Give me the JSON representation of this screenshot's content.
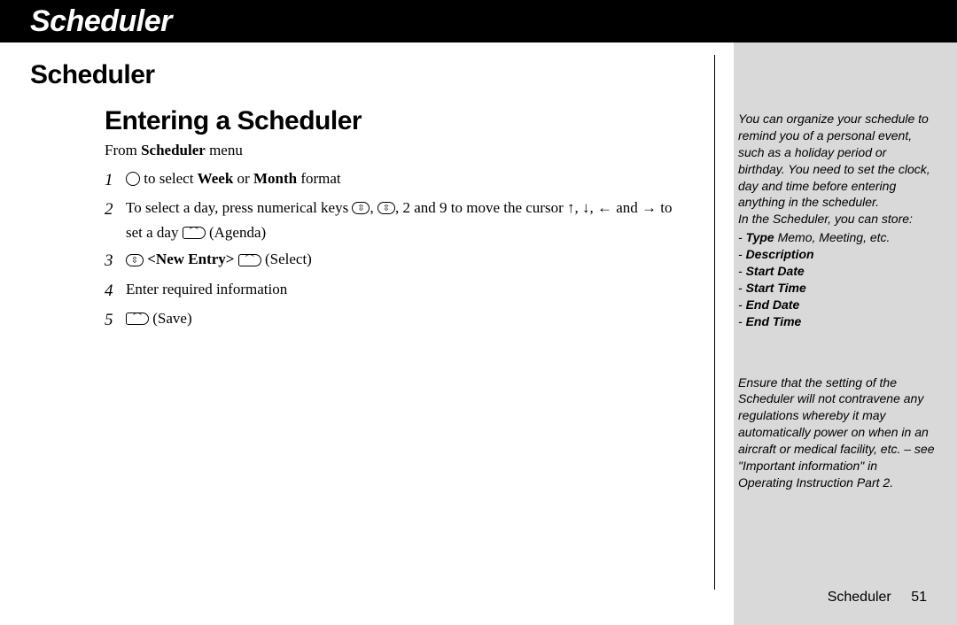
{
  "header": {
    "title": "Scheduler"
  },
  "breadcrumb": {
    "prefix": ">",
    "label": "Scheduler"
  },
  "section_label": "Scheduler",
  "heading": "Entering a Scheduler",
  "from_line": {
    "prefix": "From ",
    "bold": "Scheduler",
    "suffix": " menu"
  },
  "steps": [
    {
      "num": "1",
      "parts": [
        {
          "icon": "direction-key"
        },
        {
          "text": " to select "
        },
        {
          "bold": "Week"
        },
        {
          "text": " or "
        },
        {
          "bold": "Month"
        },
        {
          "text": " format"
        }
      ]
    },
    {
      "num": "2",
      "parts": [
        {
          "text": "To select a day, press numerical keys "
        },
        {
          "icon": "updown-key"
        },
        {
          "text": ", "
        },
        {
          "icon": "updown-key"
        },
        {
          "text": ", 2 and 9 to move the cursor ↑, ↓, ← and → to set a day "
        },
        {
          "icon": "soft-key"
        },
        {
          "text": " (Agenda)"
        }
      ]
    },
    {
      "num": "3",
      "parts": [
        {
          "icon": "updown-key"
        },
        {
          "text": " "
        },
        {
          "bold": "<New Entry>"
        },
        {
          "text": " "
        },
        {
          "icon": "soft-key"
        },
        {
          "text": " (Select)"
        }
      ]
    },
    {
      "num": "4",
      "parts": [
        {
          "text": "Enter required information"
        }
      ]
    },
    {
      "num": "5",
      "parts": [
        {
          "icon": "soft-key"
        },
        {
          "text": " (Save)"
        }
      ]
    }
  ],
  "side": {
    "intro": "You can organize your schedule to remind you of a personal event, such as a holiday period or birthday. You need to set the clock, day and time before entering anything in the scheduler.",
    "store_intro": "In the Scheduler, you can store:",
    "store_items": [
      {
        "bold": "Type",
        "suffix": " Memo, Meeting, etc."
      },
      {
        "bold": "Description",
        "suffix": ""
      },
      {
        "bold": "Start Date",
        "suffix": ""
      },
      {
        "bold": "Start Time",
        "suffix": ""
      },
      {
        "bold": "End Date",
        "suffix": ""
      },
      {
        "bold": "End Time",
        "suffix": ""
      }
    ],
    "warning": "Ensure that the setting of the Scheduler will not contravene any regulations whereby it may automatically power on when in an aircraft or medical facility, etc. – see \"Important information\" in Operating Instruction Part 2."
  },
  "footer": {
    "label": "Scheduler",
    "page": "51"
  }
}
